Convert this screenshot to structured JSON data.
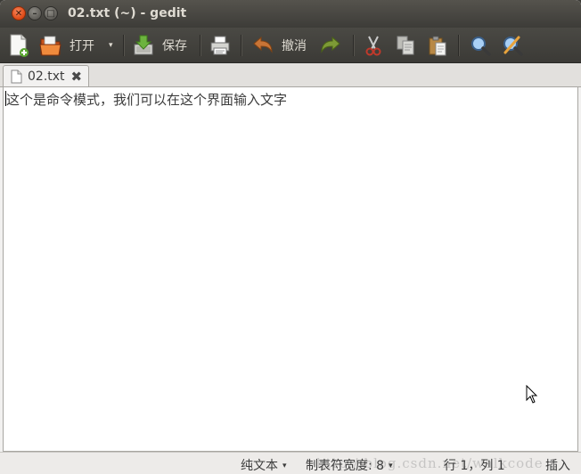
{
  "window": {
    "title": "02.txt (~) - gedit",
    "close_glyph": "✕",
    "minimize_glyph": "–",
    "maximize_glyph": "□"
  },
  "toolbar": {
    "new_icon": "new-document-icon",
    "open_label": "打开",
    "open_dropdown_glyph": "▾",
    "save_label": "保存",
    "undo_label": "撤消"
  },
  "tabs": [
    {
      "label": "02.txt",
      "close_glyph": "✖"
    }
  ],
  "editor": {
    "lines": [
      "这个是命令模式，我们可以在这个界面输入文字"
    ]
  },
  "statusbar": {
    "language": "纯文本",
    "tab_width_label": "制表符宽度: 8",
    "position": "行 1，列 1",
    "mode": "插入",
    "dropdown_glyph": "▾",
    "watermark": "http://blog.csdn.net/walkcode"
  },
  "colors": {
    "titlebar": "#3d3c38",
    "close_button": "#dd4814",
    "editor_bg": "#ffffff"
  }
}
